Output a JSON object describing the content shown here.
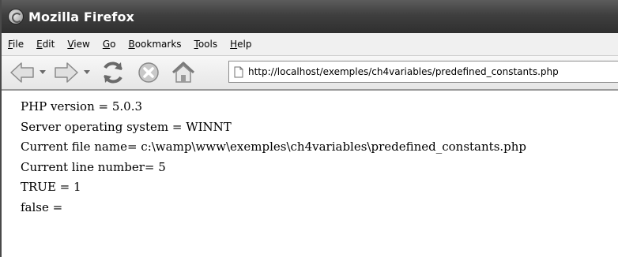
{
  "window": {
    "title": "Mozilla Firefox"
  },
  "menu": [
    {
      "accel": "F",
      "rest": "ile"
    },
    {
      "accel": "E",
      "rest": "dit"
    },
    {
      "accel": "V",
      "rest": "iew"
    },
    {
      "accel": "G",
      "rest": "o"
    },
    {
      "accel": "B",
      "rest": "ookmarks"
    },
    {
      "accel": "T",
      "rest": "ools"
    },
    {
      "accel": "H",
      "rest": "elp"
    }
  ],
  "toolbar": {
    "icons": [
      "back-arrow-icon",
      "chevron-down-icon",
      "forward-arrow-icon",
      "chevron-down-icon",
      "reload-icon",
      "stop-icon",
      "home-icon"
    ],
    "url": "http://localhost/exemples/ch4variables/predefined_constants.php"
  },
  "content": {
    "lines": [
      "PHP version = 5.0.3",
      "Server operating system = WINNT",
      "Current file name= c:\\wamp\\www\\exemples\\ch4variables\\predefined_constants.php",
      "Current line number= 5",
      "TRUE = 1",
      "false ="
    ]
  }
}
